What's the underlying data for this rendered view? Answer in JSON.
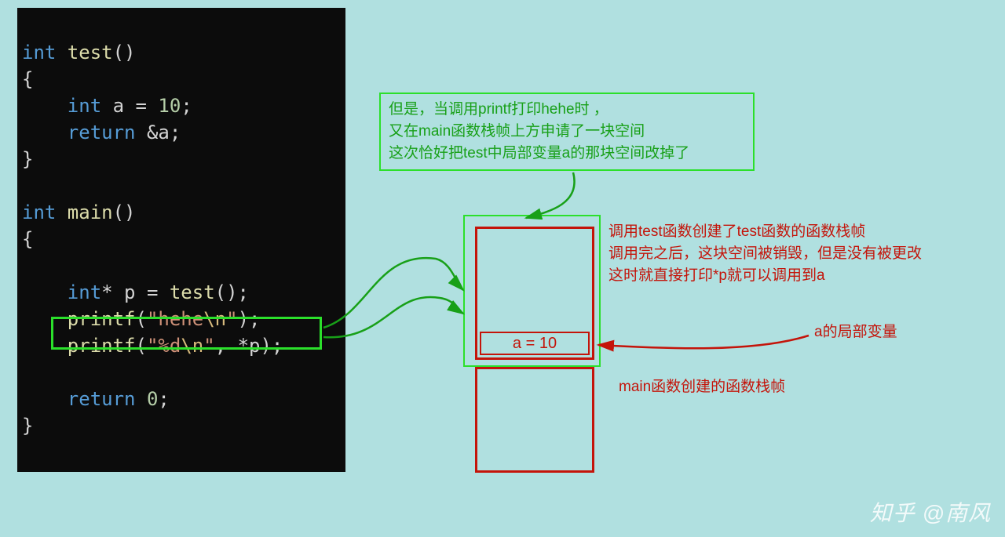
{
  "code": {
    "line1": {
      "kw": "int",
      "fn": " test",
      "rest": "()"
    },
    "line2": "{",
    "line3": {
      "kw": "    int",
      "rest": " a = ",
      "num": "10",
      "semi": ";"
    },
    "line4": {
      "kw": "    return",
      "rest": " &a;"
    },
    "line5": "}",
    "line6": "",
    "line7": {
      "kw": "int",
      "fn": " main",
      "rest": "()"
    },
    "line8": "{",
    "line9": "",
    "line10": {
      "kw": "    int",
      "rest": "* p = ",
      "fn": "test",
      "tail": "();"
    },
    "line11": {
      "fn": "    printf",
      "p1": "(",
      "str1": "\"hehe",
      "esc": "\\n",
      "str2": "\"",
      "p2": ");"
    },
    "line12": {
      "fn": "    printf",
      "p1": "(",
      "str1": "\"%d",
      "esc": "\\n",
      "str2": "\"",
      "p2": ", *p);"
    },
    "line13": "",
    "line14": {
      "kw": "    return",
      "rest": " ",
      "num": "0",
      "semi": ";"
    },
    "line15": "}"
  },
  "greenNote": {
    "l1": "但是，当调用printf打印hehe时            ，",
    "l2": "又在main函数栈帧上方申请了一块空间",
    "l3": "这次恰好把test中局部变量a的那块空间改掉了"
  },
  "redNote1": {
    "l1": "调用test函数创建了test函数的函数栈帧",
    "l2": "调用完之后，这块空间被销毁，但是没有被更改",
    "l3": "这时就直接打印*p就可以调用到a"
  },
  "labelA": "a的局部变量",
  "labelMainFrame": "main函数创建的函数栈帧",
  "cellA": "a = 10",
  "watermark": "知乎 @南风"
}
